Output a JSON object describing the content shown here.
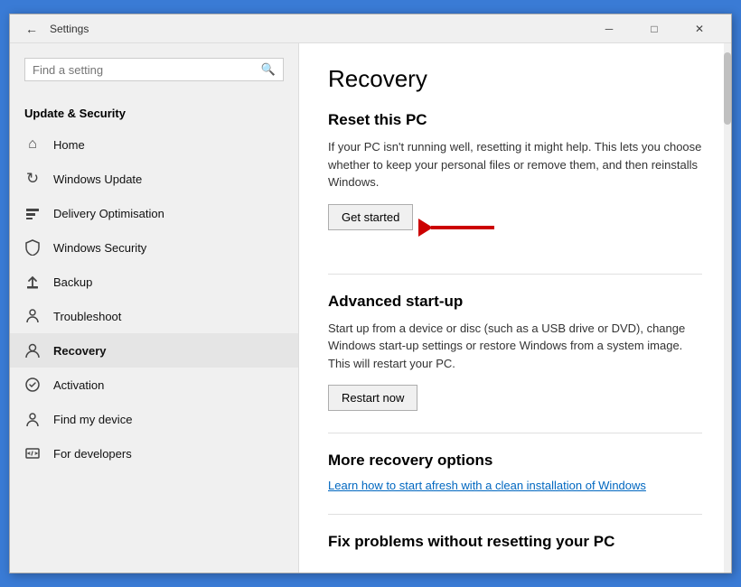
{
  "window": {
    "title": "Settings",
    "back_label": "←",
    "minimize_label": "─",
    "maximize_label": "□",
    "close_label": "✕"
  },
  "sidebar": {
    "search_placeholder": "Find a setting",
    "section_title": "Update & Security",
    "items": [
      {
        "id": "home",
        "label": "Home",
        "icon": "⌂"
      },
      {
        "id": "windows-update",
        "label": "Windows Update",
        "icon": "↻"
      },
      {
        "id": "delivery-optimisation",
        "label": "Delivery Optimisation",
        "icon": "📶"
      },
      {
        "id": "windows-security",
        "label": "Windows Security",
        "icon": "🛡"
      },
      {
        "id": "backup",
        "label": "Backup",
        "icon": "↑"
      },
      {
        "id": "troubleshoot",
        "label": "Troubleshoot",
        "icon": "🔑"
      },
      {
        "id": "recovery",
        "label": "Recovery",
        "icon": "👤"
      },
      {
        "id": "activation",
        "label": "Activation",
        "icon": "✓"
      },
      {
        "id": "find-my-device",
        "label": "Find my device",
        "icon": "👤"
      },
      {
        "id": "for-developers",
        "label": "For developers",
        "icon": "⚙"
      }
    ]
  },
  "main": {
    "page_title": "Recovery",
    "sections": [
      {
        "id": "reset-pc",
        "title": "Reset this PC",
        "description": "If your PC isn't running well, resetting it might help. This lets you choose whether to keep your personal files or remove them, and then reinstalls Windows.",
        "button_label": "Get started"
      },
      {
        "id": "advanced-startup",
        "title": "Advanced start-up",
        "description": "Start up from a device or disc (such as a USB drive or DVD), change Windows start-up settings or restore Windows from a system image. This will restart your PC.",
        "button_label": "Restart now"
      },
      {
        "id": "more-recovery",
        "title": "More recovery options",
        "link_label": "Learn how to start afresh with a clean installation of Windows"
      },
      {
        "id": "fix-problems",
        "title": "Fix problems without resetting your PC"
      }
    ]
  }
}
